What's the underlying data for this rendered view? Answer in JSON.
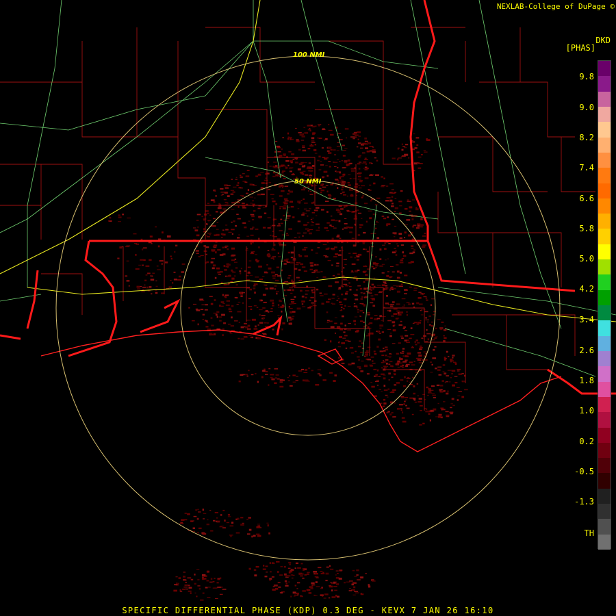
{
  "header": {
    "credit": "NEXLAB-College of DuPage ©",
    "site_code": "DKD",
    "units": "[PHAS]"
  },
  "range_rings": [
    {
      "label": "100 NMI"
    },
    {
      "label": "50 NMI"
    }
  ],
  "color_scale": {
    "labels": [
      "9.8",
      "9.0",
      "8.2",
      "7.4",
      "6.6",
      "5.8",
      "5.0",
      "4.2",
      "3.4",
      "2.6",
      "1.8",
      "1.0",
      "0.2",
      "-0.5",
      "-1.3",
      "TH"
    ],
    "colors": [
      "#6a006a",
      "#8a1a8a",
      "#c8649e",
      "#f0a8a0",
      "#ffc890",
      "#ffb070",
      "#ff9040",
      "#ff7a10",
      "#ff6a00",
      "#ff8800",
      "#ffb000",
      "#ffd000",
      "#ffff00",
      "#a0e000",
      "#20d020",
      "#00a000",
      "#008a40",
      "#40e0e0",
      "#60b0e0",
      "#a080d0",
      "#d070c8",
      "#e050a0",
      "#d02050",
      "#b01040",
      "#900020",
      "#700010",
      "#500008",
      "#300000",
      "#202020",
      "#303030",
      "#505050",
      "#707070"
    ]
  },
  "caption": "SPECIFIC DIFFERENTIAL PHASE (KDP) 0.3 DEG - KEVX 7 JAN 26 16:10"
}
